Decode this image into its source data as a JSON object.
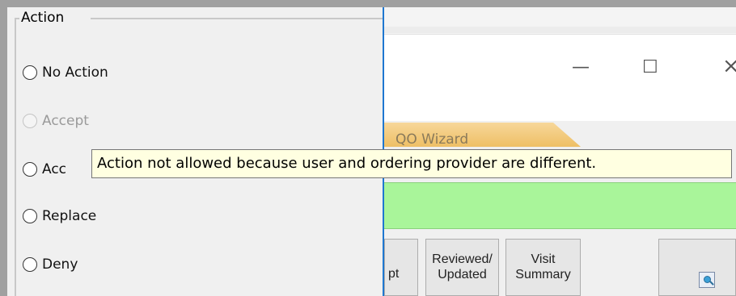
{
  "action_group": {
    "title": "Action",
    "options": [
      {
        "label": "No Action",
        "enabled": true
      },
      {
        "label": "Accept",
        "enabled": false
      },
      {
        "label": "Acc",
        "enabled": true
      },
      {
        "label": "Replace",
        "enabled": true
      },
      {
        "label": "Deny",
        "enabled": true
      }
    ]
  },
  "window": {
    "minimize_glyph": "—",
    "maximize_glyph": "☐",
    "close_glyph": "×"
  },
  "tab": {
    "label": "QO Wizard"
  },
  "buttons": {
    "partial_label": "pt",
    "reviewed_line1": "Reviewed/",
    "reviewed_line2": "Updated",
    "visit_line1": "Visit",
    "visit_line2": "Summary",
    "icon_button": "preview-icon"
  },
  "tooltip": {
    "text": "Action not allowed because user and ordering provider are different."
  },
  "colors": {
    "tooltip_bg": "#ffffe1",
    "tab_bg": "#eebf65",
    "green_bar": "#a9f59a",
    "divider": "#1f77d0"
  }
}
